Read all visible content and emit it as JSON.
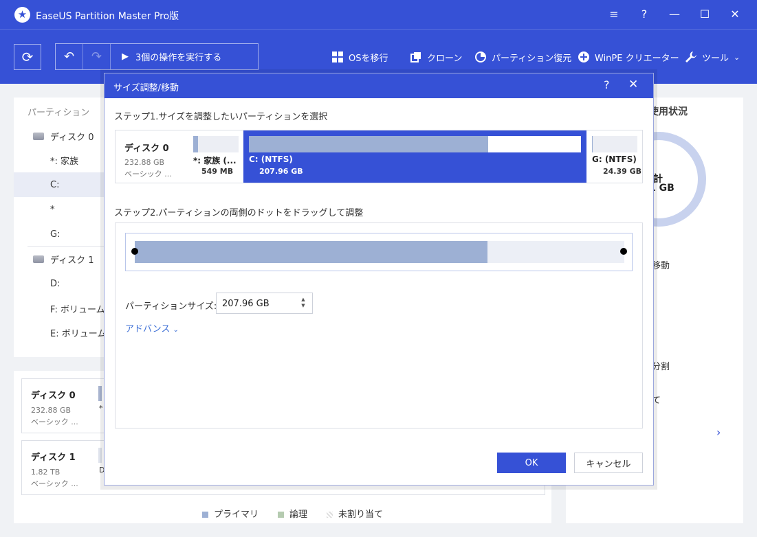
{
  "app": {
    "title": "EaseUS Partition Master Pro版",
    "controls": {
      "menu": "≡",
      "help": "?",
      "minimize": "—",
      "maximize": "☐",
      "close": "✕"
    }
  },
  "toolbar": {
    "execute_label": "3個の操作を実行する",
    "items": [
      {
        "label": "OSを移行",
        "icon": "windows-icon"
      },
      {
        "label": "クローン",
        "icon": "clone-icon"
      },
      {
        "label": "パーティション復元",
        "icon": "pie-icon"
      },
      {
        "label": "WinPE クリエーター",
        "icon": "plus-circle-icon"
      },
      {
        "label": "ツール",
        "icon": "wrench-icon"
      }
    ]
  },
  "partition_list": {
    "header": "パーティション",
    "rows": [
      {
        "kind": "disk",
        "label": "ディスク 0"
      },
      {
        "kind": "part",
        "label": "*: 家族"
      },
      {
        "kind": "part",
        "label": "C:",
        "selected": true
      },
      {
        "kind": "part",
        "label": "*"
      },
      {
        "kind": "part",
        "label": "G:"
      },
      {
        "kind": "disk",
        "label": "ディスク 1"
      },
      {
        "kind": "part",
        "label": "D:"
      },
      {
        "kind": "part",
        "label": "F: ボリューム"
      },
      {
        "kind": "part",
        "label": "E: ボリューム"
      }
    ]
  },
  "disk_map": {
    "disks": [
      {
        "name": "ディスク 0",
        "size": "232.88 GB",
        "type": "ベーシック ...",
        "peek": "*"
      },
      {
        "name": "ディスク 1",
        "size": "1.82 TB",
        "type": "ベーシック ...",
        "peek": "D"
      }
    ],
    "legend": [
      {
        "label": "プライマリ",
        "color": "#9db0d4"
      },
      {
        "label": "論理",
        "color": "#b5cbb0"
      },
      {
        "label": "未割り当て",
        "color": "#dcdcdc"
      }
    ]
  },
  "right_panel": {
    "title": "使用状況",
    "total_label": "計",
    "total_value": "1 GB",
    "ops": [
      "移動",
      "分割",
      "て"
    ],
    "next": "›"
  },
  "dialog": {
    "title": "サイズ調整/移動",
    "help": "?",
    "close": "✕",
    "step1": "ステップ1.サイズを調整したいパーティションを選択",
    "disk": {
      "name": "ディスク 0",
      "size": "232.88 GB",
      "type": "ベーシック ..."
    },
    "partitions": [
      {
        "name": "*: 家族 (...",
        "size": "549 MB",
        "used": 0.1,
        "active": false
      },
      {
        "name": "C: (NTFS)",
        "size": "207.96 GB",
        "used": 0.72,
        "active": true
      },
      {
        "name": "G: (NTFS)",
        "size": "24.39 GB",
        "used": 0.02,
        "active": false
      }
    ],
    "step2": "ステップ2.パーティションの両側のドットをドラッグして調整",
    "used_fraction": 0.72,
    "size_label": "パーティションサイズ:",
    "size_value": "207.96 GB",
    "advanced": "アドバンス",
    "ok": "OK",
    "cancel": "キャンセル",
    "colors": {
      "accent": "#3651d6",
      "used_fill": "#9db0d4"
    }
  }
}
